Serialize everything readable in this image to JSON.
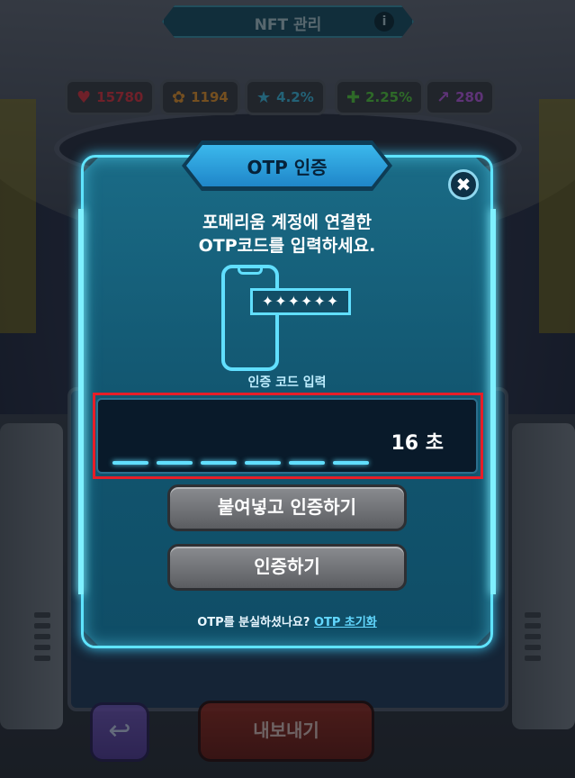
{
  "header": {
    "title": "NFT 관리",
    "info_icon": "i"
  },
  "stats": [
    {
      "icon": "heart-icon",
      "glyph": "♥",
      "value": "15780",
      "color": "#d6323d"
    },
    {
      "icon": "paw-icon",
      "glyph": "✿",
      "value": "1194",
      "color": "#e0902a"
    },
    {
      "icon": "star-icon",
      "glyph": "★",
      "value": "4.2%",
      "color": "#3fb6d8"
    },
    {
      "icon": "plus-icon",
      "glyph": "✚",
      "value": "2.25%",
      "color": "#55c63a"
    },
    {
      "icon": "arrow-icon",
      "glyph": "↗",
      "value": "280",
      "color": "#b458d9"
    }
  ],
  "modal": {
    "title": "OTP 인증",
    "close_icon": "✖",
    "instruction_line1": "포메리움 계정에 연결한",
    "instruction_line2": "OTP코드를 입력하세요.",
    "code_masked": "✦✦✦✦✦✦",
    "code_label": "인증 코드 입력",
    "timer": "16 초",
    "paste_button": "붙여넣고 인증하기",
    "verify_button": "인증하기",
    "footer_text": "OTP를 분실하셨나요?",
    "footer_link": "OTP 초기화"
  },
  "bottom": {
    "back_icon": "↩",
    "export_button": "내보내기"
  }
}
